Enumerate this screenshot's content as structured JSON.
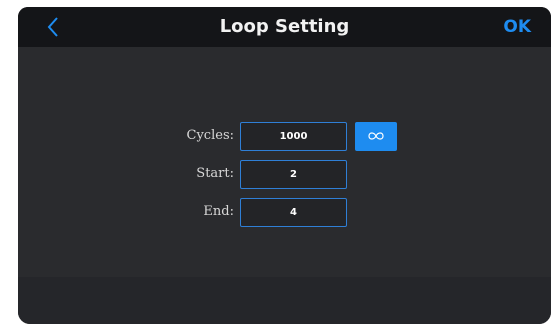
{
  "header": {
    "title": "Loop Setting",
    "ok_label": "OK",
    "back_icon": "chevron-left-icon"
  },
  "form": {
    "cycles_label": "Cycles:",
    "cycles_value": "1000",
    "infinite_icon": "infinity-icon",
    "start_label": "Start:",
    "start_value": "2",
    "end_label": "End:",
    "end_value": "4"
  },
  "colors": {
    "accent": "#1e8cf0",
    "field_border": "#2f7fd6",
    "background": "#2a2b2e",
    "header_background": "#141518"
  }
}
